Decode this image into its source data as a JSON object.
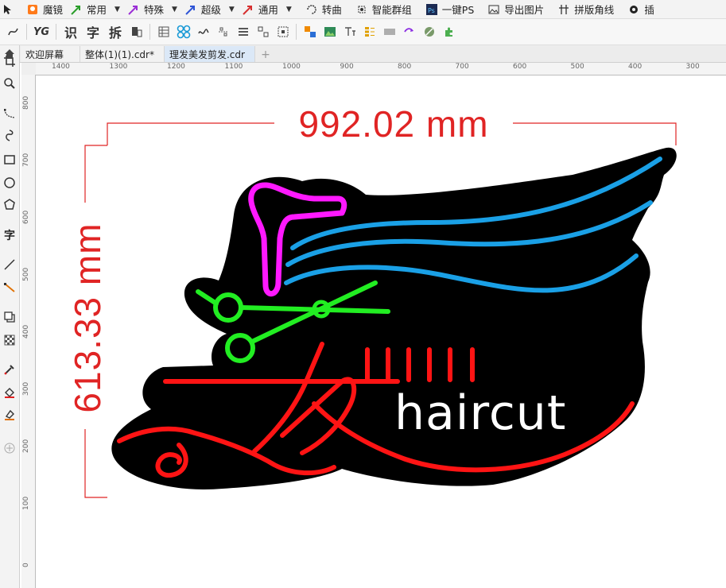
{
  "menu": [
    {
      "label": "魔镜",
      "icon": "magic-mirror-icon",
      "dropdown": false
    },
    {
      "label": "常用",
      "icon": "arrow-green-icon",
      "dropdown": true
    },
    {
      "label": "特殊",
      "icon": "arrow-purple-icon",
      "dropdown": true
    },
    {
      "label": "超级",
      "icon": "arrow-blue-icon",
      "dropdown": true
    },
    {
      "label": "通用",
      "icon": "arrow-red-icon",
      "dropdown": true
    },
    {
      "label": "转曲",
      "icon": "curve-icon",
      "dropdown": false
    },
    {
      "label": "智能群组",
      "icon": "group-icon",
      "dropdown": false
    },
    {
      "label": "一键PS",
      "icon": "ps-icon",
      "dropdown": false
    },
    {
      "label": "导出图片",
      "icon": "image-icon",
      "dropdown": false
    },
    {
      "label": "拼版角线",
      "icon": "crop-marks-icon",
      "dropdown": false
    },
    {
      "label": "插",
      "icon": "gear-icon",
      "dropdown": false
    }
  ],
  "toolbar": {
    "yg_label": "YG",
    "recognize_label": "识",
    "char_label": "字",
    "split_label": "拆"
  },
  "tabs": [
    {
      "label": "欢迎屏幕",
      "active": false
    },
    {
      "label": "整体(1)(1).cdr*",
      "active": false
    },
    {
      "label": "理发美发剪发.cdr",
      "active": true
    }
  ],
  "tools": {
    "text_tool_label": "字"
  },
  "ruler_top": [
    "1400",
    "1300",
    "1200",
    "1100",
    "1000",
    "900",
    "800",
    "700",
    "600",
    "500",
    "400",
    "300"
  ],
  "ruler_left": [
    "800",
    "700",
    "600",
    "500",
    "400",
    "300",
    "200",
    "100",
    "0"
  ],
  "artwork": {
    "width_dimension": "992.02 mm",
    "height_dimension": "613.33 mm",
    "sign_text": "haircut",
    "colors": {
      "dimension": "#e02424",
      "background": "#000000",
      "dryer": "#ff19ff",
      "scissors": "#22ee22",
      "waves": "#1aa0e6",
      "red_strokes": "#ff1414",
      "text": "#ffffff"
    }
  }
}
